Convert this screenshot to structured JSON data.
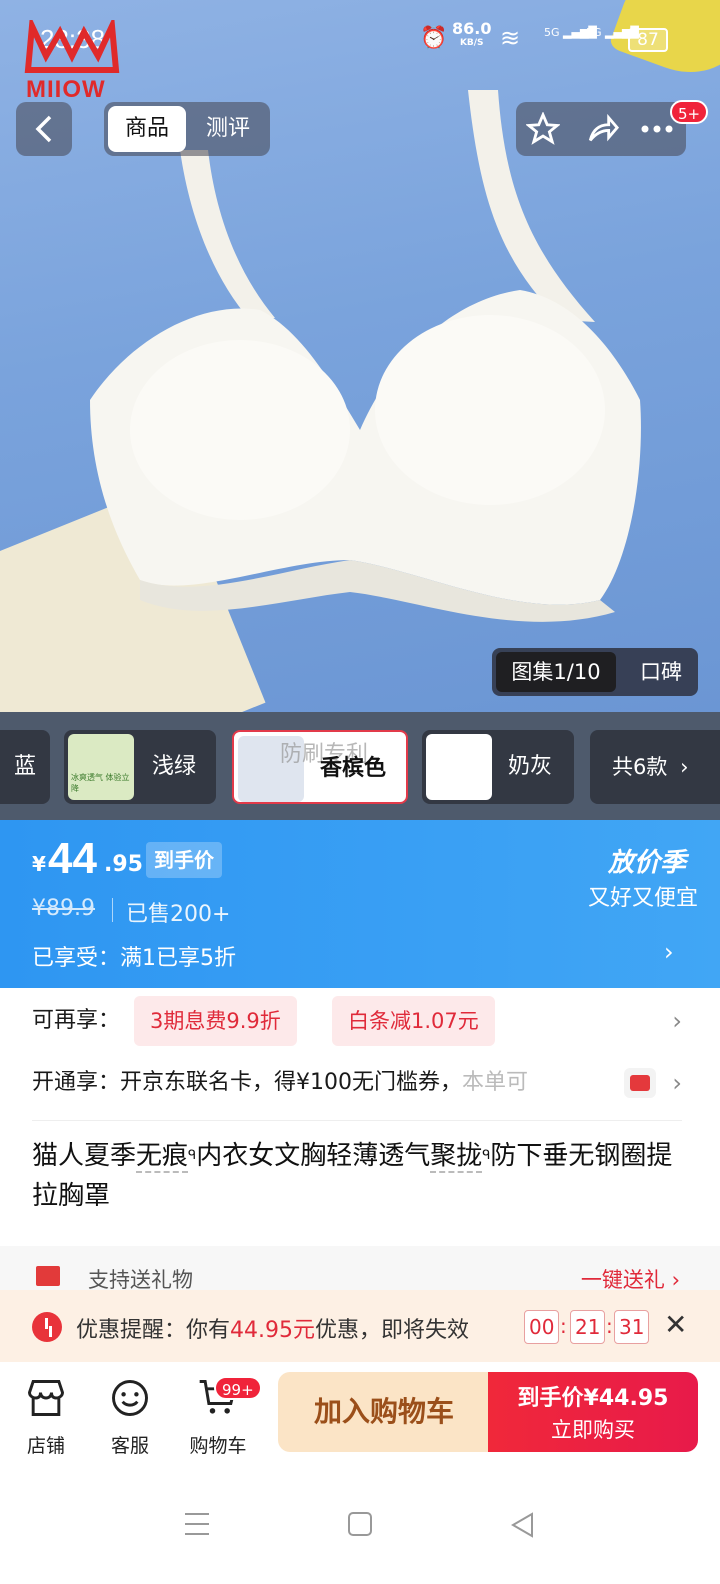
{
  "status_bar": {
    "time": "23:38",
    "net_speed": "86.0",
    "net_unit": "KB/S",
    "sim1": "5G",
    "sim2": "5G",
    "battery": "87"
  },
  "logo_text": "MIIOW",
  "header": {
    "tabs": [
      {
        "label": "商品",
        "active": true
      },
      {
        "label": "测评",
        "active": false
      }
    ],
    "badge": "5+"
  },
  "gallery": {
    "counter": "图集1/10",
    "reviews": "口碑"
  },
  "variants": [
    {
      "label": "蓝",
      "color": "#9ab6e0"
    },
    {
      "label": "浅绿",
      "color": "#cfe8a8",
      "thumb_text": "冰爽透气 体验立降"
    },
    {
      "label": "香槟色",
      "color": "#f2ede2",
      "selected": true,
      "watermark": "防刷专利"
    },
    {
      "label": "奶灰",
      "color": "#e8e8e8"
    }
  ],
  "variants_more": "共6款",
  "price": {
    "currency": "¥",
    "integer": "44",
    "decimal": ".95",
    "tag": "到手价",
    "original": "¥89.9",
    "sold": "已售200+",
    "promo": "已享受：满1已享5折",
    "campaign_title": "放价季",
    "campaign_sub": "又好又便宜"
  },
  "offers": {
    "row1_label": "可再享：",
    "chip1": "3期息费9.9折",
    "chip2": "白条减1.07元",
    "row2_label": "开通享：",
    "row2_text": "开京东联名卡，得¥100无门槛券，",
    "row2_more": "本单可"
  },
  "title": {
    "part1": "猫人夏季",
    "keyword1": "无痕",
    "part2": "内衣女文胸轻薄透气",
    "keyword2": "聚拢",
    "part3": "防下垂无钢圈提拉胸罩"
  },
  "gift": {
    "label": "支持送礼物",
    "action": "一键送礼 ›"
  },
  "reminder": {
    "prefix": "优惠提醒：你有",
    "amount": "44.95元",
    "suffix": "优惠，即将失效",
    "hh": "00",
    "mm": "21",
    "ss": "31"
  },
  "bottom_bar": {
    "shop": "店铺",
    "service": "客服",
    "cart": "购物车",
    "cart_badge": "99+",
    "add_to_cart": "加入购物车",
    "buy_price_label": "到手价¥44.95",
    "buy_now": "立即购买"
  },
  "colors": {
    "accent_blue": "#2e96f2",
    "accent_red": "#e02a3a",
    "cart_button": "#fbe4c6"
  }
}
